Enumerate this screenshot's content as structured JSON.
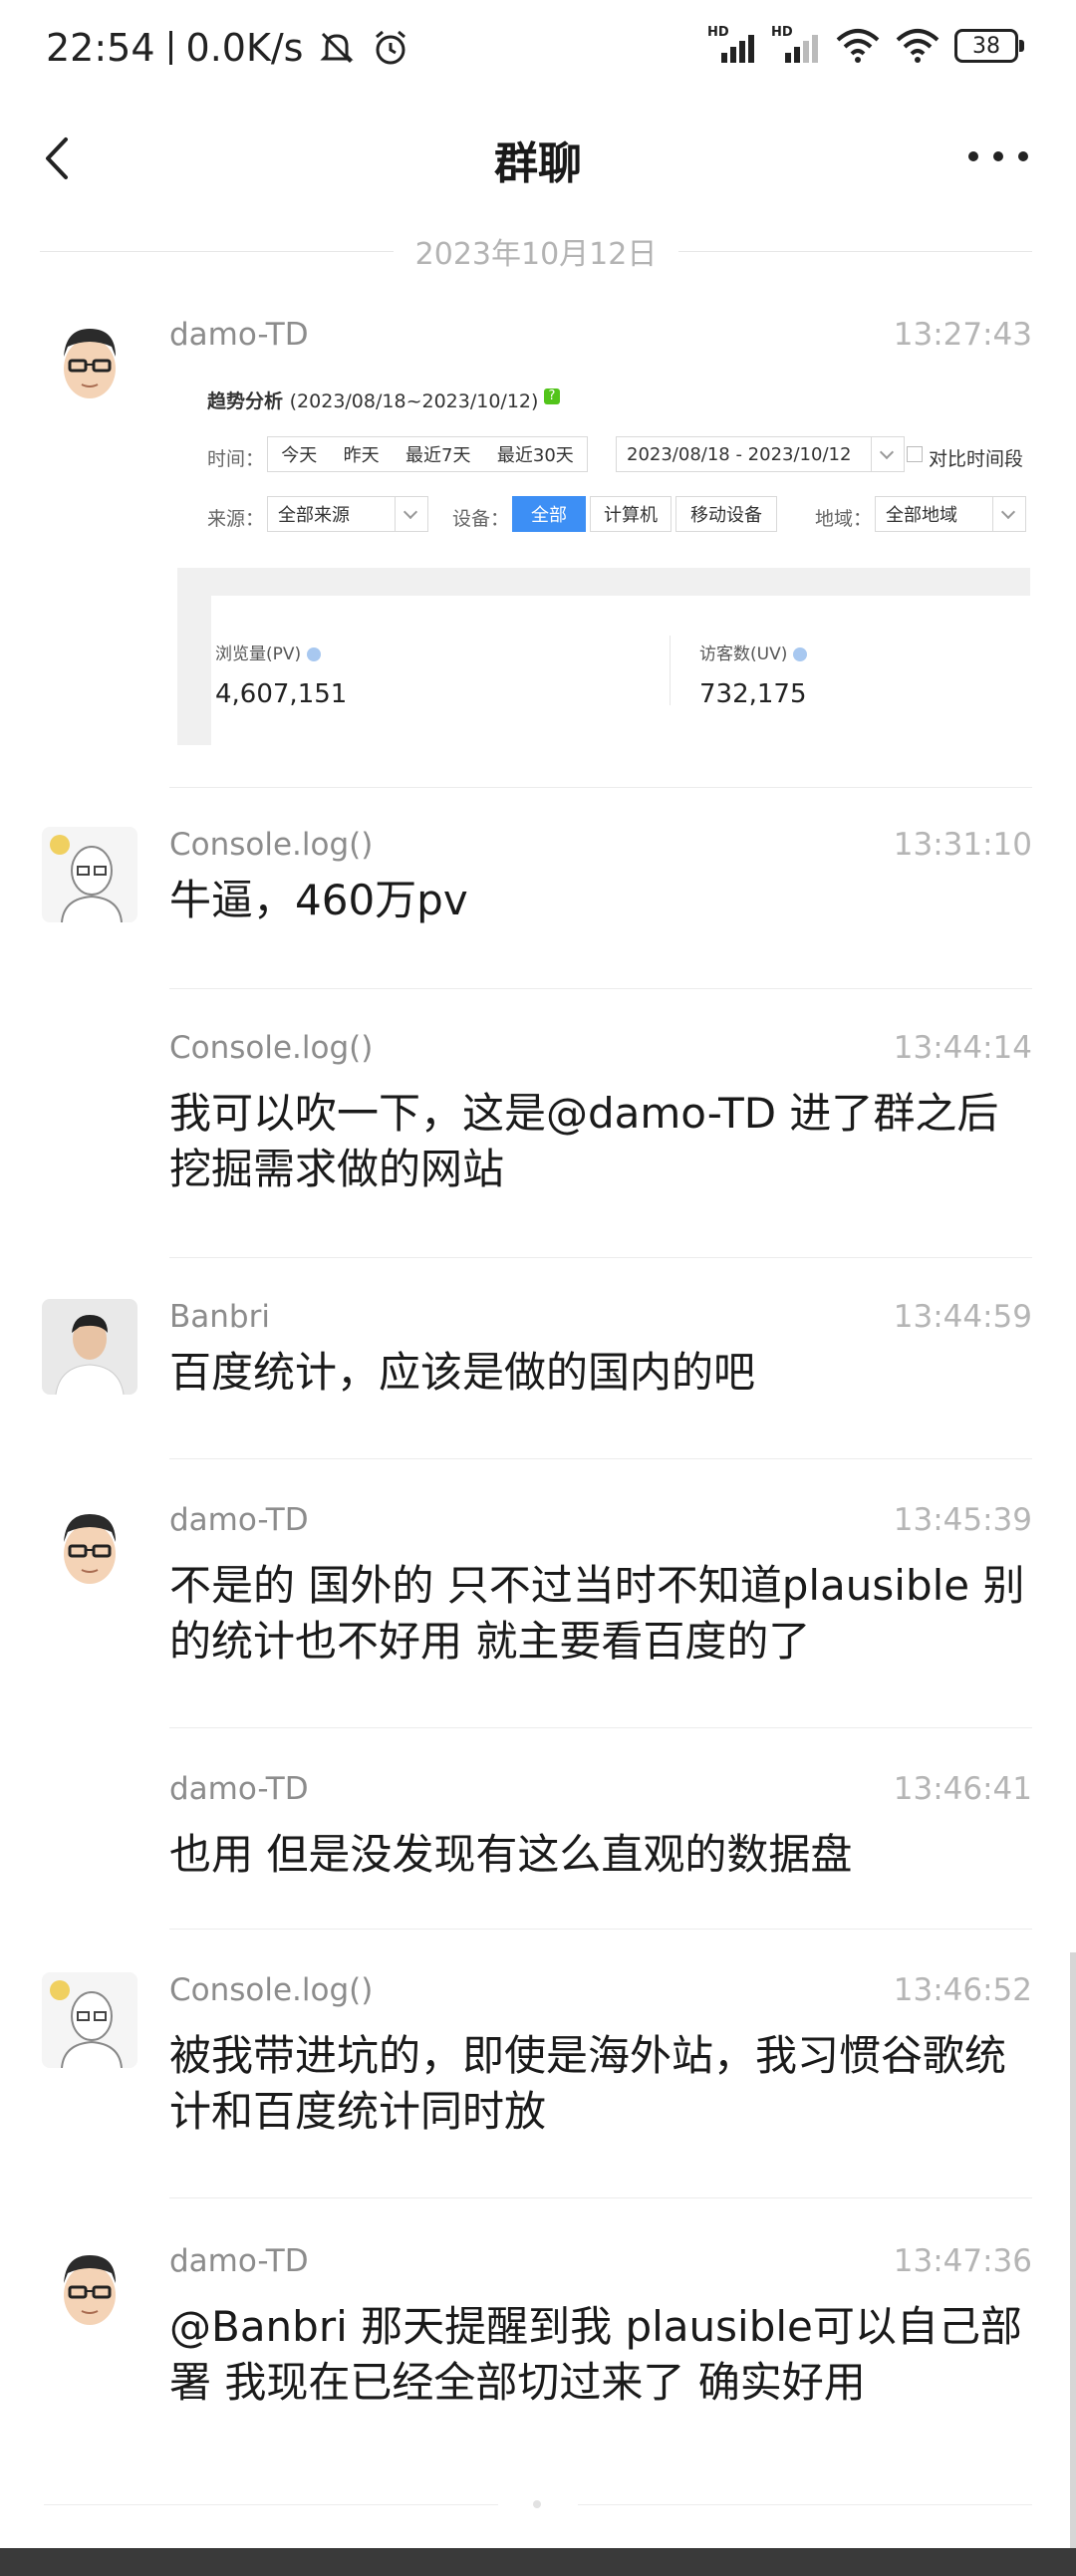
{
  "status": {
    "time": "22:54",
    "net_speed": "0.0K/s",
    "battery": "38",
    "hd_label": "HD"
  },
  "header": {
    "title": "群聊"
  },
  "date_separator": "2023年10月12日",
  "screenshot": {
    "title": "趋势分析",
    "range": "(2023/08/18~2023/10/12)",
    "time_label": "时间：",
    "time_tabs": [
      "今天",
      "昨天",
      "最近7天",
      "最近30天"
    ],
    "date_range": "2023/08/18 - 2023/10/12",
    "compare_label": "对比时间段",
    "source_label": "来源：",
    "source_value": "全部来源",
    "device_label": "设备：",
    "device_tabs": [
      "全部",
      "计算机",
      "移动设备"
    ],
    "region_label": "地域：",
    "region_value": "全部地域",
    "pv_label": "浏览量(PV)",
    "pv_value": "4,607,151",
    "uv_label": "访客数(UV)",
    "uv_value": "732,175",
    "accent": "#3d8ff5"
  },
  "messages": [
    {
      "name": "damo-TD",
      "time": "13:27:43",
      "avatar": "avatar-glasses-man"
    },
    {
      "name": "Console.log()",
      "time": "13:31:10",
      "text": "牛逼，460万pv",
      "avatar": "avatar-bald-man"
    },
    {
      "name": "Console.log()",
      "time": "13:44:14",
      "text": "我可以吹一下，这是@damo-TD 进了群之后挖掘需求做的网站"
    },
    {
      "name": "Banbri",
      "time": "13:44:59",
      "text": "百度统计，应该是做的国内的吧",
      "avatar": "avatar-photo-man"
    },
    {
      "name": "damo-TD",
      "time": "13:45:39",
      "text": "不是的 国外的 只不过当时不知道plausible 别的统计也不好用 就主要看百度的了",
      "avatar": "avatar-glasses-man"
    },
    {
      "name": "damo-TD",
      "time": "13:46:41",
      "text": "也用 但是没发现有这么直观的数据盘"
    },
    {
      "name": "Console.log()",
      "time": "13:46:52",
      "text": "被我带进坑的，即使是海外站，我习惯谷歌统计和百度统计同时放",
      "avatar": "avatar-bald-man"
    },
    {
      "name": "damo-TD",
      "time": "13:47:36",
      "text": "@Banbri 那天提醒到我 plausible可以自己部署 我现在已经全部切过来了 确实好用",
      "avatar": "avatar-glasses-man"
    }
  ]
}
